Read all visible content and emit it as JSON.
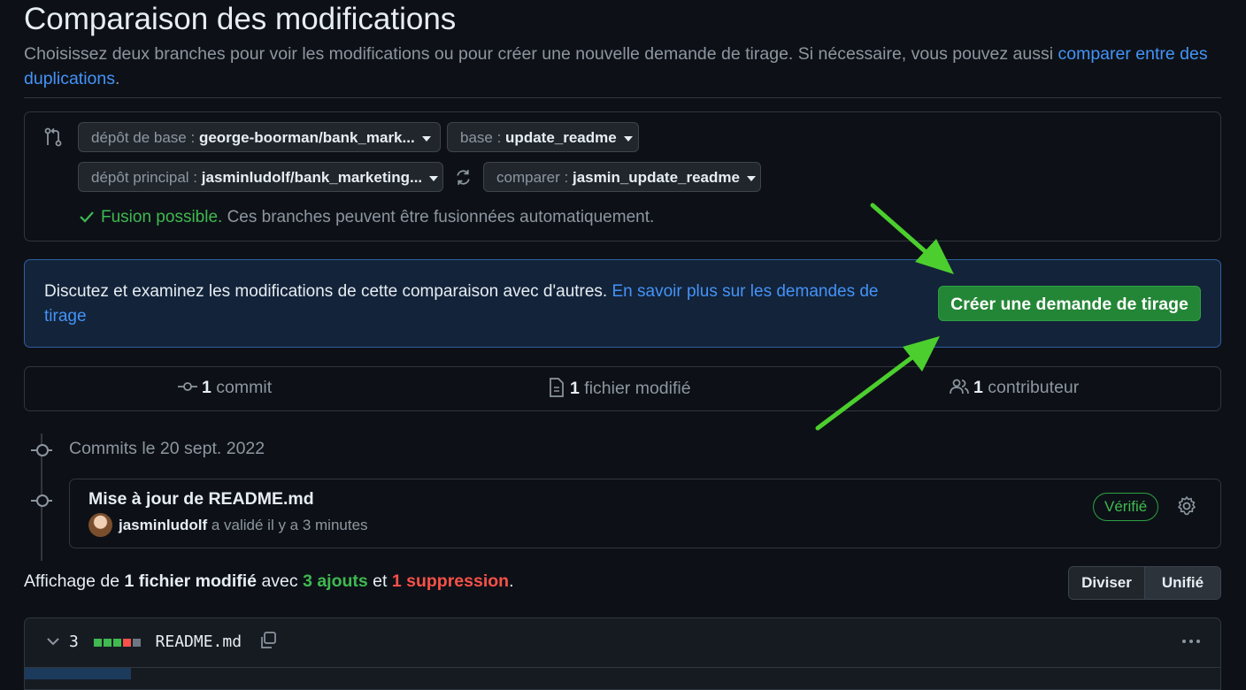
{
  "page": {
    "title": "Comparaison des modifications",
    "subtitle_text": "Choisissez deux branches pour voir les modifications ou pour créer une nouvelle demande de tirage. Si nécessaire, vous pouvez aussi ",
    "subtitle_link": "comparer entre des duplications",
    "subtitle_end": "."
  },
  "compare": {
    "base_repo_label": "dépôt de base :",
    "base_repo_value": "george-boorman/bank_mark...",
    "base_label": "base :",
    "base_value": "update_readme",
    "head_repo_label": "dépôt principal :",
    "head_repo_value": "jasminludolf/bank_marketing...",
    "compare_label": "comparer :",
    "compare_value": "jasmin_update_readme",
    "merge_status": "Fusion possible.",
    "merge_message": " Ces branches peuvent être fusionnées automatiquement."
  },
  "info": {
    "text": "Discutez et examinez les modifications de cette comparaison avec d'autres. ",
    "link": "En savoir plus sur les demandes de tirage",
    "create_button": "Créer une demande de tirage"
  },
  "stats": {
    "commits_count": "1",
    "commits_label": " commit",
    "files_count": "1",
    "files_label": " fichier modifié",
    "contributors_count": "1",
    "contributors_label": " contributeur"
  },
  "commits": {
    "date_header": "Commits le 20 sept. 2022",
    "items": [
      {
        "title": "Mise à jour de README.md",
        "author": "jasminludolf",
        "meta": " a validé il y a 3 minutes",
        "badge": "Vérifié"
      }
    ]
  },
  "summary": {
    "prefix": "Affichage de ",
    "files": "1 fichier modifié",
    "mid": " avec ",
    "additions": "3 ajouts",
    "and": " et ",
    "deletions": "1 suppression",
    "end": "."
  },
  "view_toggle": {
    "split": "Diviser",
    "unified": "Unifié"
  },
  "file": {
    "changes": "3",
    "name": "README.md"
  },
  "colors": {
    "accent_green": "#238636",
    "link_blue": "#4493f8",
    "add_green": "#3fb950",
    "del_red": "#f85149",
    "annotation_arrow": "#4ccf2e"
  }
}
